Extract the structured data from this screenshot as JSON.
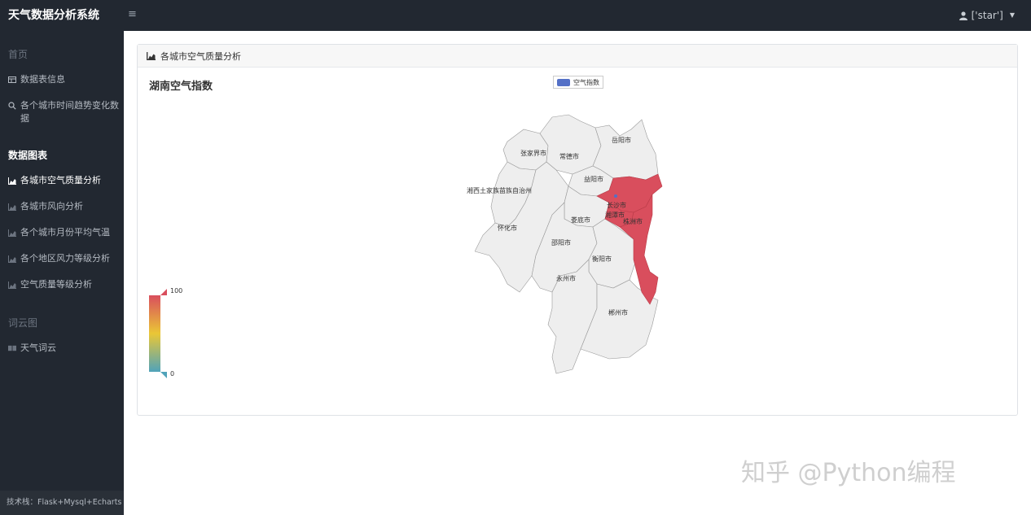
{
  "app": {
    "title": "天气数据分析系统",
    "user": "['star']"
  },
  "sidebar": {
    "sections": [
      {
        "header": "首页",
        "items": [
          {
            "label": "数据表信息",
            "icon": "table-icon"
          },
          {
            "label": "各个城市时间趋势变化数据",
            "icon": "search-icon"
          }
        ]
      },
      {
        "header": "数据图表",
        "items": [
          {
            "label": "各城市空气质量分析",
            "icon": "area-chart-icon",
            "active": true
          },
          {
            "label": "各城市风向分析",
            "icon": "area-chart-icon"
          },
          {
            "label": "各个城市月份平均气温",
            "icon": "area-chart-icon"
          },
          {
            "label": "各个地区风力等级分析",
            "icon": "area-chart-icon"
          },
          {
            "label": "空气质量等级分析",
            "icon": "area-chart-icon"
          }
        ]
      },
      {
        "header": "词云图",
        "items": [
          {
            "label": "天气词云",
            "icon": "book-icon"
          }
        ]
      }
    ],
    "footer": "技术栈：Flask+Mysql+Echarts"
  },
  "panel": {
    "heading": "各城市空气质量分析"
  },
  "chart_data": {
    "type": "map",
    "title": "湖南空气指数",
    "series": [
      {
        "name": "空气指数",
        "color": "#5470c6"
      }
    ],
    "visual_map": {
      "min": 0,
      "max": 100,
      "min_label": "0",
      "max_label": "100",
      "colors": [
        "#50a3ba",
        "#eac736",
        "#d94e5d"
      ]
    },
    "regions": [
      {
        "name": "张家界市",
        "highlighted": false
      },
      {
        "name": "常德市",
        "highlighted": false
      },
      {
        "name": "岳阳市",
        "highlighted": false
      },
      {
        "name": "益阳市",
        "highlighted": false
      },
      {
        "name": "湘西土家族苗族自治州",
        "highlighted": false
      },
      {
        "name": "长沙市",
        "highlighted": true
      },
      {
        "name": "湘潭市",
        "highlighted": true
      },
      {
        "name": "株洲市",
        "highlighted": true
      },
      {
        "name": "娄底市",
        "highlighted": false
      },
      {
        "name": "怀化市",
        "highlighted": false
      },
      {
        "name": "邵阳市",
        "highlighted": false
      },
      {
        "name": "衡阳市",
        "highlighted": false
      },
      {
        "name": "永州市",
        "highlighted": false
      },
      {
        "name": "郴州市",
        "highlighted": false
      }
    ],
    "highlight_color": "#d94e5d",
    "base_color": "#eeeeee"
  },
  "watermark": "知乎 @Python编程"
}
